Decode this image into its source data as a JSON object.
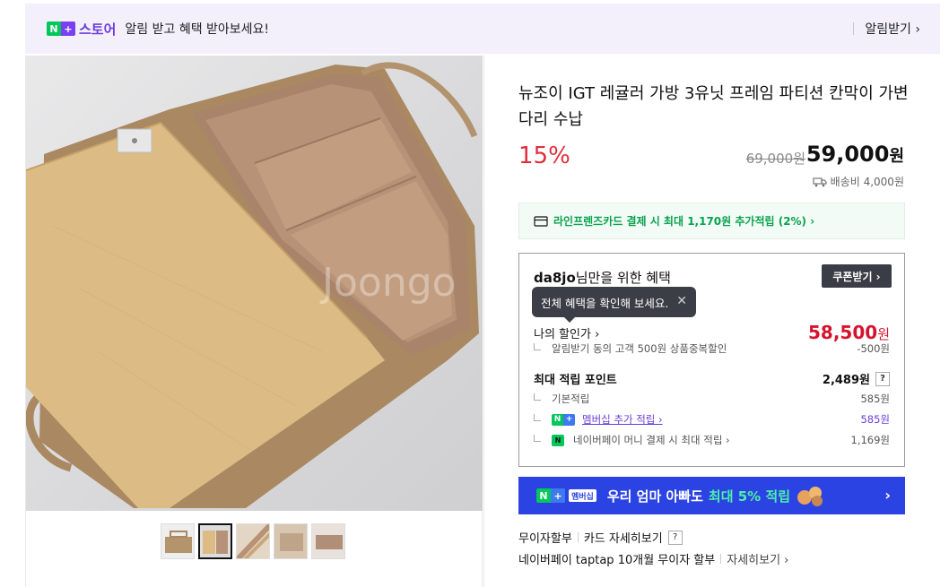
{
  "banner": {
    "store_label": "스토어",
    "message": "알림 받고 혜택 받아보세요!",
    "alarm_button": "알림받기 ›"
  },
  "gallery": {
    "watermark": "Joongo",
    "thumbnails": [
      "thumb-1",
      "thumb-2",
      "thumb-3",
      "thumb-4",
      "thumb-5"
    ],
    "active_index": 1
  },
  "product": {
    "title": "뉴조이 IGT 레귤러 가방 3유닛 프레임 파티션 칸막이 가변다리 수납",
    "discount": "15%",
    "original_price": "69,000원",
    "price_value": "59,000",
    "price_unit": "원",
    "shipping": "배송비 4,000원"
  },
  "card_promo": {
    "text": "라인프렌즈카드 결제 시 최대 1,170원 추가적립 (2%) ›"
  },
  "benefit": {
    "user": "da8jo",
    "title_suffix": "님만을 위한 혜택",
    "coupon_button": "쿠폰받기 ›",
    "tooltip": "전체 혜택을 확인해 보세요.",
    "tooltip_close": "✕",
    "my_discount_label": "나의 할인가 ›",
    "my_discount_value": "58,500",
    "my_discount_unit": "원",
    "discount_detail_label": "알림받기 동의 고객 500원 상품중복할인",
    "discount_detail_value": "-500원",
    "points_label": "최대 적립 포인트",
    "points_value": "2,489원",
    "points_help": "?",
    "basic_label": "기본적립",
    "basic_value": "585원",
    "membership_label": "멤버십 추가 적립 ›",
    "membership_value": "585원",
    "pay_label": "네이버페이 머니 결제 시 최대 적립 ›",
    "pay_value": "1,169원"
  },
  "membership_banner": {
    "tag": "멤버십",
    "text": "우리 엄마 아빠도",
    "highlight": "최대 5% 적립",
    "chevron": "›"
  },
  "footer": {
    "installment": "무이자할부",
    "card_detail": "카드 자세히보기",
    "help": "?",
    "taptap": "네이버페이 taptap 10개월 무이자 할부",
    "detail": "자세히보기 ›"
  },
  "colors": {
    "accent_red": "#e12e3c",
    "naver_green": "#03c75a",
    "store_purple": "#6a3cdb",
    "membership_blue": "#2c43e3"
  }
}
